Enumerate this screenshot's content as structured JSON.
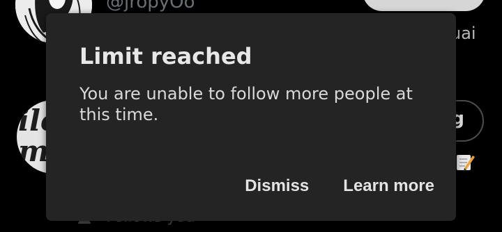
{
  "background": {
    "handle": "@jropyOo",
    "side_text": "uai",
    "follow_button_partial": "g",
    "follows_you": "Follows you",
    "avatar_text": "ilo\nm"
  },
  "dialog": {
    "title": "Limit reached",
    "message": "You are unable to follow more people at this time.",
    "dismiss_label": "Dismiss",
    "learn_more_label": "Learn more"
  },
  "colors": {
    "page_background": "#000000",
    "dialog_background": "#242424",
    "dialog_text": "#e7e7e7",
    "dimmed_text": "#6b6f73"
  }
}
